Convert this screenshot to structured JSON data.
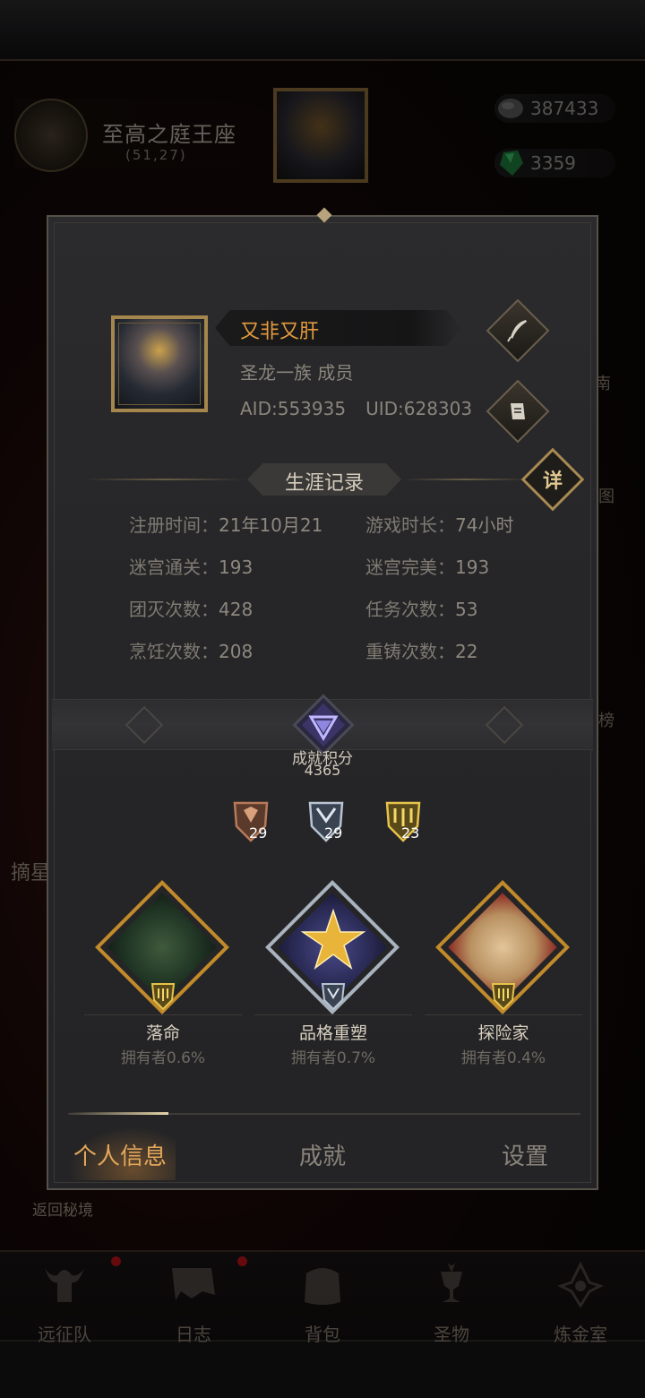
{
  "location": {
    "title": "至高之庭王座",
    "coords": "(51,27)"
  },
  "resources": {
    "stone": "387433",
    "gem": "3359"
  },
  "side_labels": [
    "南",
    "图",
    "榜"
  ],
  "left_label": "摘星",
  "return_label": "返回秘境",
  "bottom_nav": [
    {
      "label": "远征队",
      "icon": "helmet-icon"
    },
    {
      "label": "日志",
      "icon": "scroll-icon"
    },
    {
      "label": "背包",
      "icon": "bag-icon"
    },
    {
      "label": "圣物",
      "icon": "chalice-icon"
    },
    {
      "label": "炼金室",
      "icon": "alchemy-icon"
    }
  ],
  "profile": {
    "name": "又非又肝",
    "guild": "圣龙一族 成员",
    "aid": "AID:553935",
    "uid": "UID:628303"
  },
  "career": {
    "title": "生涯记录",
    "detail_label": "详",
    "stats": [
      {
        "label": "注册时间：",
        "value": "21年10月21"
      },
      {
        "label": "游戏时长：",
        "value": "74小时"
      },
      {
        "label": "迷宫通关：",
        "value": "193"
      },
      {
        "label": "迷宫完美：",
        "value": "193"
      },
      {
        "label": "团灭次数：",
        "value": "428"
      },
      {
        "label": "任务次数：",
        "value": "53"
      },
      {
        "label": "烹饪次数：",
        "value": "208"
      },
      {
        "label": "重铸次数：",
        "value": "22"
      }
    ]
  },
  "achievement": {
    "label": "成就积分",
    "score": "4365",
    "badges": [
      {
        "tier": "bronze",
        "count": "29"
      },
      {
        "tier": "silver",
        "count": "29"
      },
      {
        "tier": "gold",
        "count": "23"
      }
    ],
    "cards": [
      {
        "name": "落命",
        "owners": "拥有者0.6%"
      },
      {
        "name": "品格重塑",
        "owners": "拥有者0.7%"
      },
      {
        "name": "探险家",
        "owners": "拥有者0.4%"
      }
    ]
  },
  "tabs": [
    {
      "label": "个人信息",
      "active": true
    },
    {
      "label": "成就",
      "active": false
    },
    {
      "label": "设置",
      "active": false
    }
  ]
}
